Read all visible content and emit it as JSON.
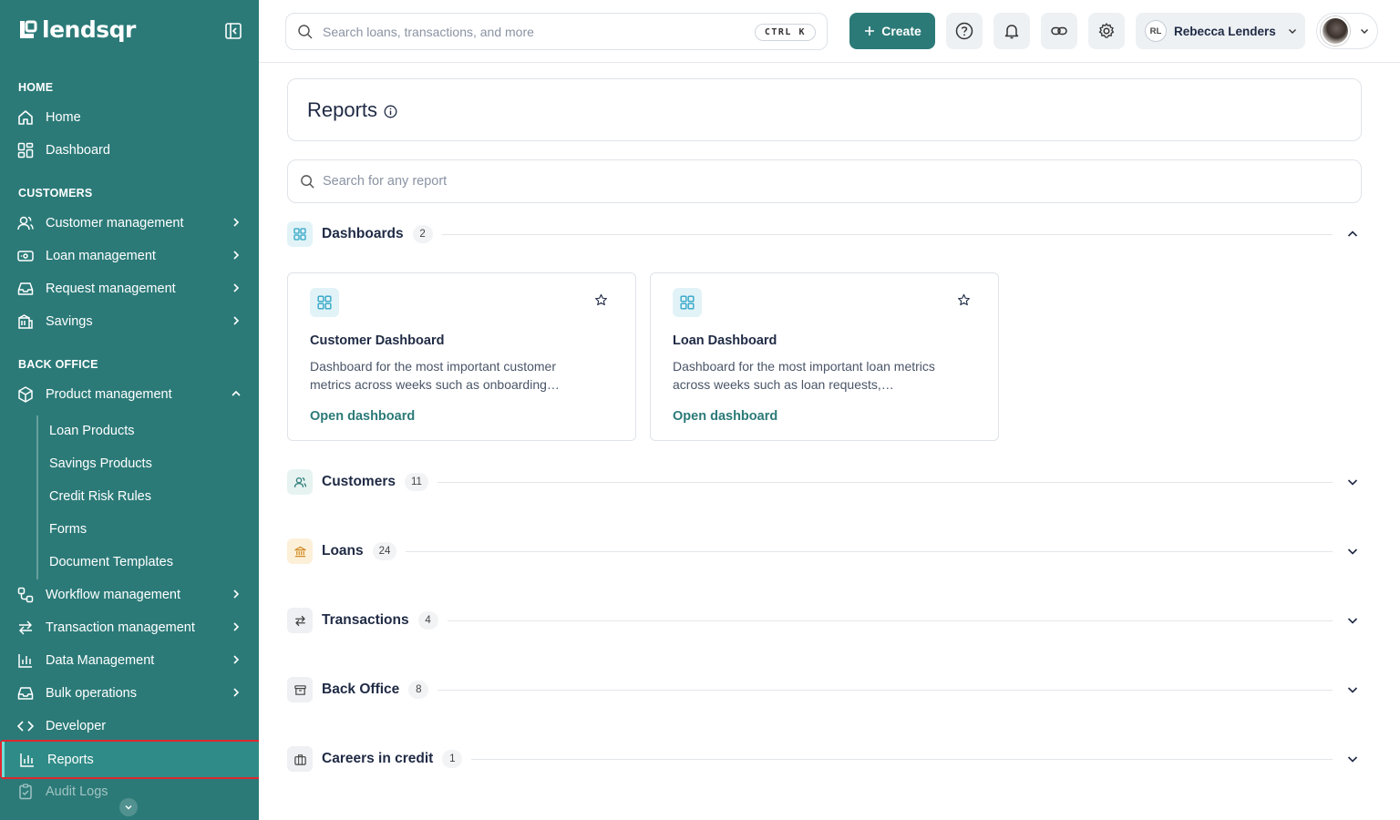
{
  "app": {
    "logo_text": "lendsqr",
    "accent": "#2b7a78",
    "sidebar_bg": "#2b7a78"
  },
  "topbar": {
    "search_placeholder": "Search loans, transactions, and more",
    "shortcut": "CTRL K",
    "create_label": "Create",
    "icons": [
      "help-icon",
      "bell-icon",
      "link-icon",
      "settings-icon"
    ],
    "user_initials": "RL",
    "user_name": "Rebecca Lenders"
  },
  "sidebar": {
    "home_heading": "HOME",
    "customers_heading": "CUSTOMERS",
    "back_office_heading": "BACK OFFICE",
    "home": "Home",
    "dashboard": "Dashboard",
    "customer_management": "Customer management",
    "loan_management": "Loan management",
    "request_management": "Request management",
    "savings": "Savings",
    "product_management": "Product management",
    "sub_items": [
      "Loan Products",
      "Savings Products",
      "Credit Risk Rules",
      "Forms",
      "Document Templates"
    ],
    "workflow_management": "Workflow management",
    "transaction_management": "Transaction management",
    "data_management": "Data Management",
    "bulk_operations": "Bulk operations",
    "developer": "Developer",
    "reports": "Reports",
    "audit_logs": "Audit Logs",
    "active_item": "Reports"
  },
  "main": {
    "title": "Reports",
    "search_placeholder": "Search for any report",
    "sections": [
      {
        "title": "Dashboards",
        "count": "2",
        "expanded": true
      },
      {
        "title": "Customers",
        "count": "11",
        "expanded": false
      },
      {
        "title": "Loans",
        "count": "24",
        "expanded": false
      },
      {
        "title": "Transactions",
        "count": "4",
        "expanded": false
      },
      {
        "title": "Back Office",
        "count": "8",
        "expanded": false
      },
      {
        "title": "Careers in credit",
        "count": "1",
        "expanded": false
      }
    ],
    "dashboards": [
      {
        "title": "Customer Dashboard",
        "description": "Dashboard for the most important customer metrics across weeks such as onboarding…",
        "link": "Open dashboard"
      },
      {
        "title": "Loan Dashboard",
        "description": "Dashboard for the most important loan metrics across weeks such as loan requests, approvals,…",
        "link": "Open dashboard"
      }
    ]
  }
}
